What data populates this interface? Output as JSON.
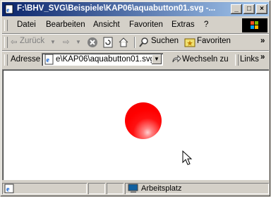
{
  "window": {
    "title": "F:\\BHV_SVG\\Beispiele\\KAP06\\aquabutton01.svg -..."
  },
  "menu": [
    "Datei",
    "Bearbeiten",
    "Ansicht",
    "Favoriten",
    "Extras",
    "?"
  ],
  "toolbar": {
    "back_label": "Zurück",
    "search_label": "Suchen",
    "favorites_label": "Favoriten"
  },
  "address": {
    "label": "Adresse",
    "value": "e\\KAP06\\aquabutton01.svg",
    "go_label": "Wechseln zu",
    "links_label": "Links"
  },
  "status": {
    "zone_label": "Arbeitsplatz"
  },
  "colors": {
    "button_fill": "#ff0000",
    "title_start": "#0a246a",
    "title_end": "#a6caf0"
  }
}
